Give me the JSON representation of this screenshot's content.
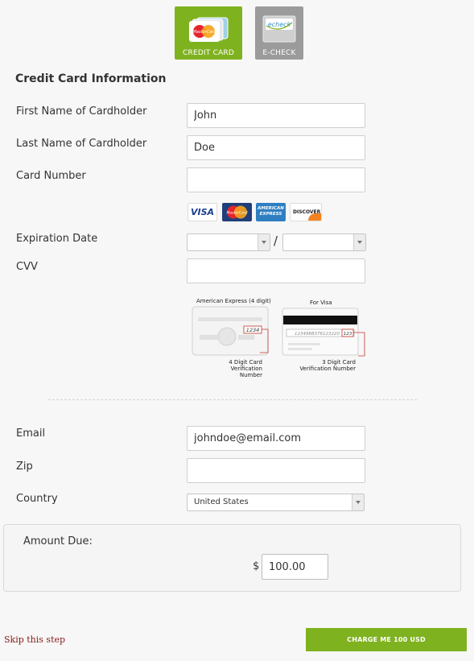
{
  "payment_methods": [
    {
      "label": "CREDIT CARD",
      "logo_text": "MasterCard",
      "active": true
    },
    {
      "label": "E-CHECK",
      "logo_text": "echeck",
      "active": false
    }
  ],
  "section_title": "Credit Card Information",
  "fields": {
    "first_name": {
      "label": "First Name of Cardholder",
      "value": "John"
    },
    "last_name": {
      "label": "Last Name of Cardholder",
      "value": "Doe"
    },
    "card_number": {
      "label": "Card Number",
      "value": ""
    },
    "expiration": {
      "label": "Expiration Date",
      "month": "",
      "year": "",
      "separator": "/"
    },
    "cvv": {
      "label": "CVV",
      "value": ""
    },
    "email": {
      "label": "Email",
      "value": "johndoe@email.com"
    },
    "zip": {
      "label": "Zip",
      "value": ""
    },
    "country": {
      "label": "Country",
      "value": "United States"
    }
  },
  "card_logos": [
    "VISA",
    "MasterCard",
    "AMERICAN EXPRESS",
    "DISCOVER"
  ],
  "cvv_help": {
    "amex_caption": "American Express (4 digit)",
    "amex_code": "1234",
    "amex_note_line1": "4 Digit Card",
    "amex_note_line2": "Verification Number",
    "visa_caption": "For Visa",
    "visa_digits": "1234988376123220",
    "visa_code": "123",
    "visa_note_line1": "3 Digit Card",
    "visa_note_line2": "Verification Number"
  },
  "amount": {
    "label": "Amount Due:",
    "currency_symbol": "$",
    "value": "100.00"
  },
  "actions": {
    "skip_label": "Skip this step",
    "charge_label": "CHARGE ME 100 USD"
  },
  "colors": {
    "accent": "#7fb21f",
    "inactive_tab": "#9b9b9b",
    "skip_link": "#8a1a1a"
  }
}
